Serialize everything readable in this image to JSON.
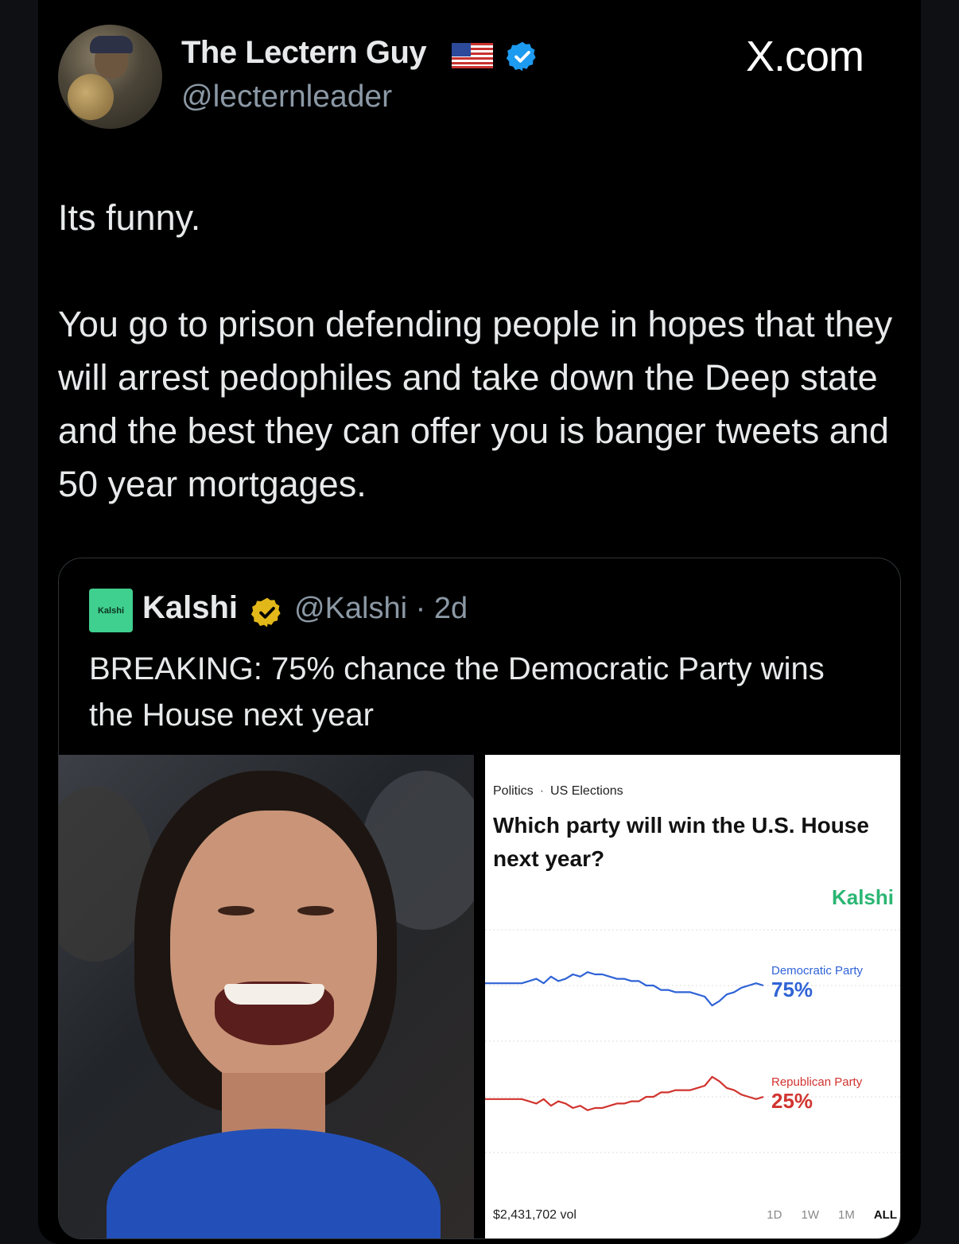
{
  "tweet": {
    "display_name": "The Lectern Guy",
    "handle": "@lecternleader",
    "site": "X.com",
    "text": "Its funny.\n\nYou go to prison defending people in hopes that they will arrest pedophiles and take down the Deep state and the best they can offer you is banger tweets and 50 year mortgages."
  },
  "quote": {
    "logo_text": "Kalshi",
    "name": "Kalshi",
    "handle_time": "@Kalshi · 2d",
    "text": "BREAKING: 75% chance the Democratic Party wins the House next year"
  },
  "card": {
    "crumb1": "Politics",
    "crumb_sep": "·",
    "crumb2": "US Elections",
    "title": "Which party will win the U.S. House next year?",
    "brand": "Kalshi",
    "volume": "$2,431,702 vol",
    "ranges": [
      "1D",
      "1W",
      "1M",
      "ALL"
    ]
  },
  "chart_data": {
    "type": "line",
    "series": [
      {
        "name": "Democratic Party",
        "label": "75%",
        "color": "#2f63d6",
        "values": [
          76,
          76,
          76,
          76,
          76,
          76,
          77,
          78,
          76,
          79,
          77,
          78,
          80,
          79,
          81,
          80,
          80,
          79,
          78,
          78,
          77,
          77,
          75,
          75,
          73,
          73,
          72,
          72,
          72,
          71,
          70,
          66,
          68,
          71,
          72,
          74,
          75,
          76,
          75
        ]
      },
      {
        "name": "Republican Party",
        "label": "25%",
        "color": "#d1342f",
        "values": [
          24,
          24,
          24,
          24,
          24,
          24,
          23,
          22,
          24,
          21,
          23,
          22,
          20,
          21,
          19,
          20,
          20,
          21,
          22,
          22,
          23,
          23,
          25,
          25,
          27,
          27,
          28,
          28,
          28,
          29,
          30,
          34,
          32,
          29,
          28,
          26,
          25,
          24,
          25
        ]
      }
    ],
    "ylim": [
      0,
      100
    ],
    "grid": true,
    "legend": "inline-right"
  },
  "colors": {
    "verified_blue": "#1d9bf0",
    "verified_gold": "#e2b719",
    "kalshi_green": "#2bb673"
  }
}
